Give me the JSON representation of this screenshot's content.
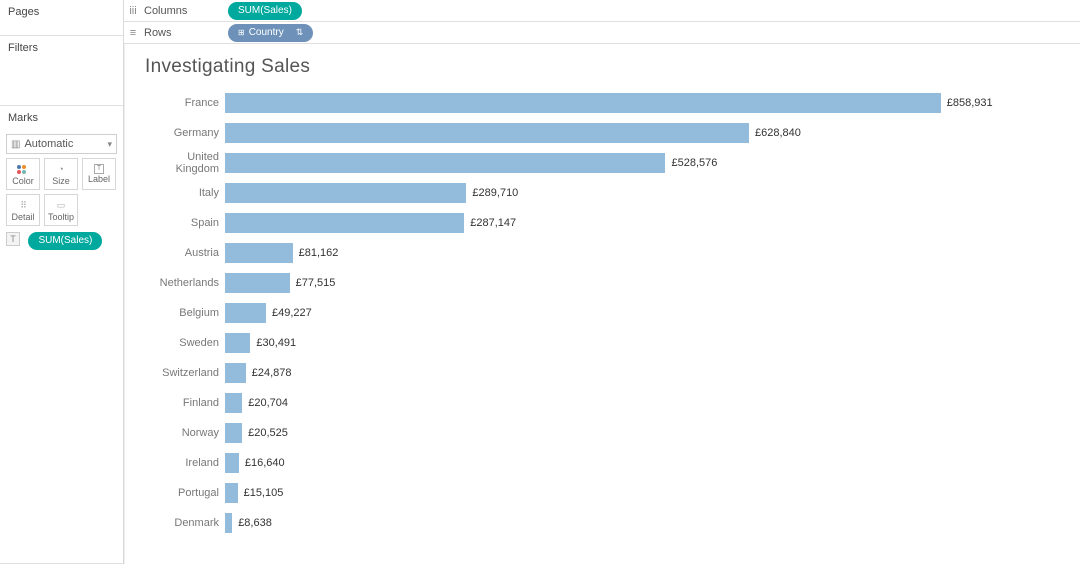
{
  "panels": {
    "pages_label": "Pages",
    "filters_label": "Filters",
    "marks_label": "Marks",
    "marks_dropdown": "Automatic",
    "mark_buttons": {
      "color": "Color",
      "size": "Size",
      "label": "Label",
      "detail": "Detail",
      "tooltip": "Tooltip"
    },
    "marks_pill": "SUM(Sales)"
  },
  "shelves": {
    "columns_label": "Columns",
    "rows_label": "Rows",
    "columns_pill": "SUM(Sales)",
    "rows_pill": "Country"
  },
  "chart_data": {
    "type": "bar",
    "title": "Investigating Sales",
    "xlabel": "",
    "ylabel": "",
    "xlim": [
      0,
      900000
    ],
    "currency_prefix": "£",
    "bar_color": "#92bbdc",
    "categories": [
      "France",
      "Germany",
      "United Kingdom",
      "Italy",
      "Spain",
      "Austria",
      "Netherlands",
      "Belgium",
      "Sweden",
      "Switzerland",
      "Finland",
      "Norway",
      "Ireland",
      "Portugal",
      "Denmark"
    ],
    "values": [
      858931,
      628840,
      528576,
      289710,
      287147,
      81162,
      77515,
      49227,
      30491,
      24878,
      20704,
      20525,
      16640,
      15105,
      8638
    ],
    "value_labels": [
      "£858,931",
      "£628,840",
      "£528,576",
      "£289,710",
      "£287,147",
      "£81,162",
      "£77,515",
      "£49,227",
      "£30,491",
      "£24,878",
      "£20,704",
      "£20,525",
      "£16,640",
      "£15,105",
      "£8,638"
    ]
  }
}
